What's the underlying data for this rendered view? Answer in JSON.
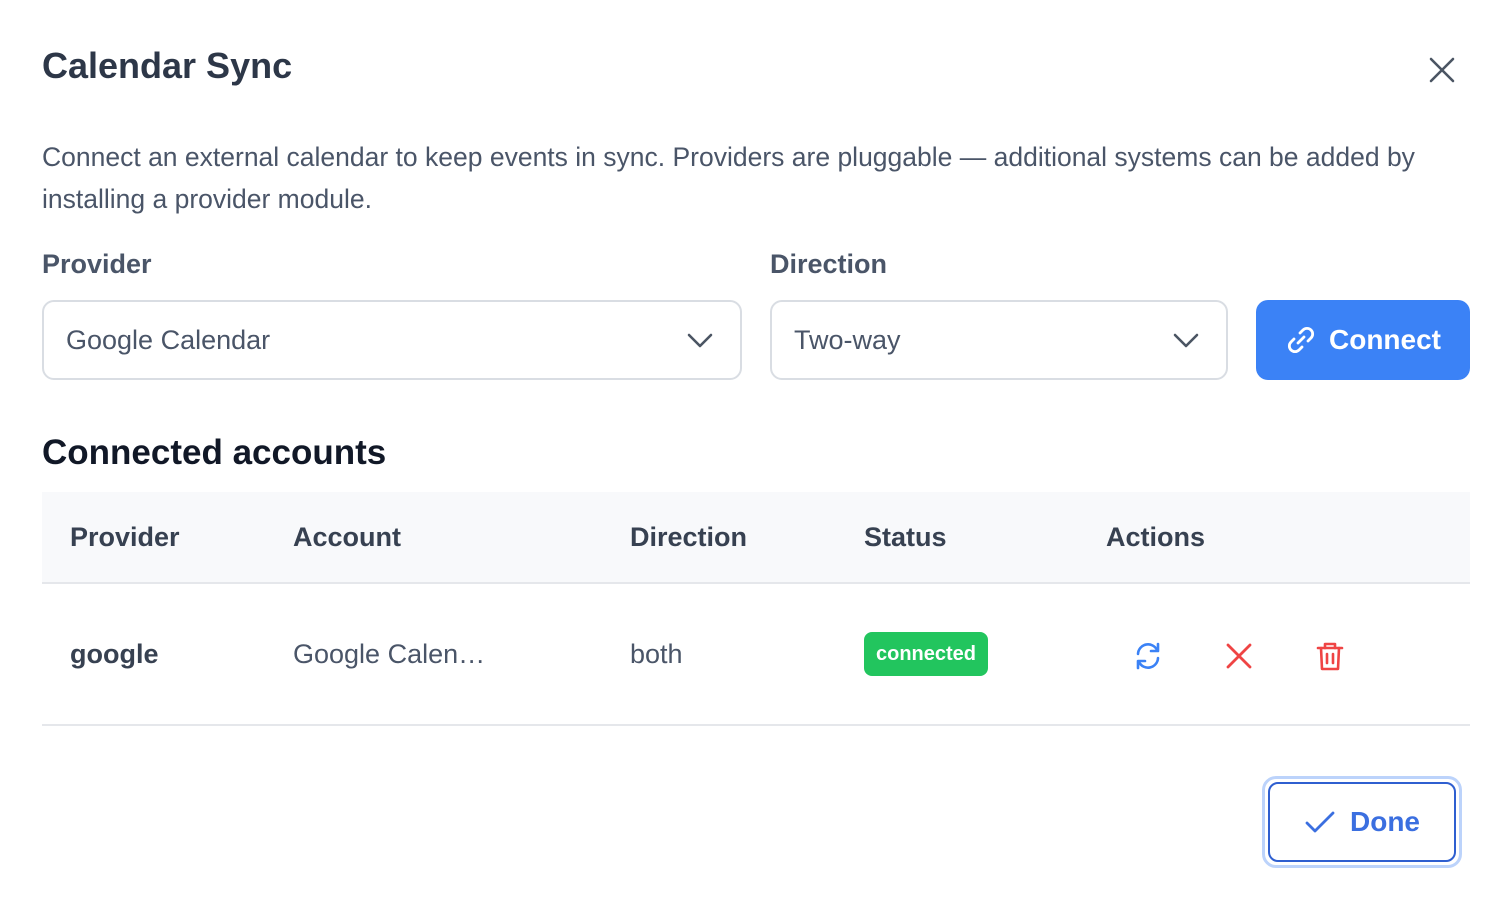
{
  "dialog": {
    "title": "Calendar Sync",
    "description": "Connect an external calendar to keep events in sync. Providers are pluggable — additional systems can be added by installing a provider module.",
    "close_icon": "close-icon"
  },
  "form": {
    "provider_label": "Provider",
    "provider_value": "Google Calendar",
    "direction_label": "Direction",
    "direction_value": "Two-way",
    "connect_label": "Connect",
    "connect_icon": "link-icon"
  },
  "accounts": {
    "title": "Connected accounts",
    "columns": [
      "Provider",
      "Account",
      "Direction",
      "Status",
      "Actions"
    ],
    "rows": [
      {
        "provider": "google",
        "account": "Google Calen…",
        "direction": "both",
        "status": "connected",
        "actions": [
          "refresh-icon",
          "disconnect-icon",
          "trash-icon"
        ]
      }
    ]
  },
  "footer": {
    "done_label": "Done",
    "done_icon": "check-icon"
  },
  "colors": {
    "primary": "#3b82f6",
    "status_connected": "#22c55e",
    "danger": "#ef4444"
  }
}
